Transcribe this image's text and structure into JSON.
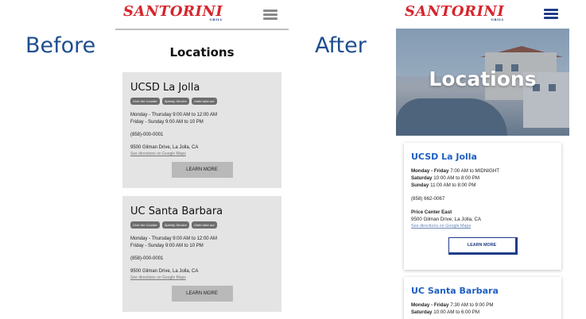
{
  "labels": {
    "before": "Before",
    "after": "After"
  },
  "wireframe": {
    "logo_text": "SANTORINI",
    "logo_sub": "GRILL",
    "page_title": "Locations",
    "tags": [
      "Over the Counter",
      "Speedy Service",
      "Order take-out"
    ],
    "locations": [
      {
        "name": "UCSD La Jolla",
        "hours": [
          "Monday - Thursday 9:00 AM to 12:00 AM",
          "Friday - Sunday 9:00 AM to 10 PM"
        ],
        "phone": "(858)-000-0001",
        "address": "9500 Gilman Drive, La Jolla, CA",
        "directions": "See directions on Google Maps",
        "button": "LEARN MORE"
      },
      {
        "name": "UC Santa Barbara",
        "hours": [
          "Monday - Thursday 9:00 AM to 12:00 AM",
          "Friday - Sunday 9:00 AM to 10 PM"
        ],
        "phone": "(858)-000-0001",
        "address": "9500 Gilman Drive, La Jolla, CA",
        "directions": "See directions on Google Maps",
        "button": "LEARN MORE"
      }
    ]
  },
  "final": {
    "logo_text": "SANTORINI",
    "logo_sub": "GRILL",
    "hero_title": "Locations",
    "locations": [
      {
        "name": "UCSD La Jolla",
        "hours": [
          {
            "days": "Monday - Friday",
            "time": "7:00 AM to MIDNIGHT"
          },
          {
            "days": "Saturday",
            "time": "10:00 AM to 8:00 PM"
          },
          {
            "days": "Sunday",
            "time": "11:00 AM to 8:00 PM"
          }
        ],
        "phone": "(858) 662-0067",
        "place": "Price Center East",
        "address": "9500 Gilman Drive, La Jolla, CA",
        "directions": "See directions on Google Maps",
        "button": "LEARN MORE"
      },
      {
        "name": "UC Santa Barbara",
        "hours": [
          {
            "days": "Monday - Friday",
            "time": "7:30 AM to 9:00 PM"
          },
          {
            "days": "Saturday",
            "time": "10:00 AM to 6:00 PM"
          }
        ]
      }
    ]
  },
  "colors": {
    "brand_red": "#d6252d",
    "brand_blue": "#1f3c88",
    "link_blue": "#1f5fc2",
    "label_blue": "#1f4e8f"
  }
}
